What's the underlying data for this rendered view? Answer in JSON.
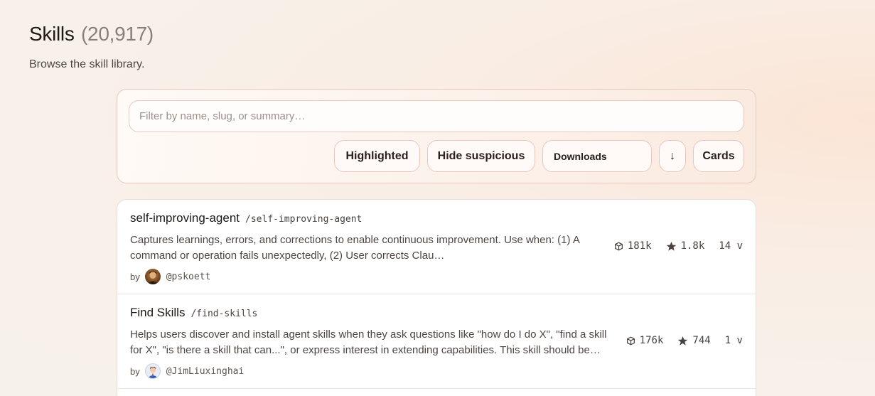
{
  "header": {
    "title": "Skills",
    "count": "(20,917)",
    "subtitle": "Browse the skill library."
  },
  "filters": {
    "search_placeholder": "Filter by name, slug, or summary…",
    "search_value": "",
    "highlighted_label": "Highlighted",
    "hide_suspicious_label": "Hide suspicious",
    "sort_selected": "Downloads",
    "sort_direction": "↓",
    "view_label": "Cards"
  },
  "skills": [
    {
      "name": "self-improving-agent",
      "slug": "/self-improving-agent",
      "summary_line1": "Captures learnings, errors, and corrections to enable continuous improvement. Use when: (1) A",
      "summary_line2": "command or operation fails unexpectedly, (2) User corrects Clau…",
      "by": "by",
      "author": "@pskoett",
      "downloads": "181k",
      "stars": "1.8k",
      "versions": "14 v",
      "avatar_icon": "author-photo"
    },
    {
      "name": "Find Skills",
      "slug": "/find-skills",
      "summary_line1": "Helps users discover and install agent skills when they ask questions like \"how do I do X\", \"find a skill",
      "summary_line2": "for X\", \"is there a skill that can...\", or express interest in extending capabilities. This skill should be…",
      "by": "by",
      "author": "@JimLiuxinghai",
      "downloads": "176k",
      "stars": "744",
      "versions": "1 v",
      "avatar_icon": "cartoon-avatar"
    }
  ],
  "icons": {
    "downloads": "package-icon",
    "stars": "star-icon"
  }
}
